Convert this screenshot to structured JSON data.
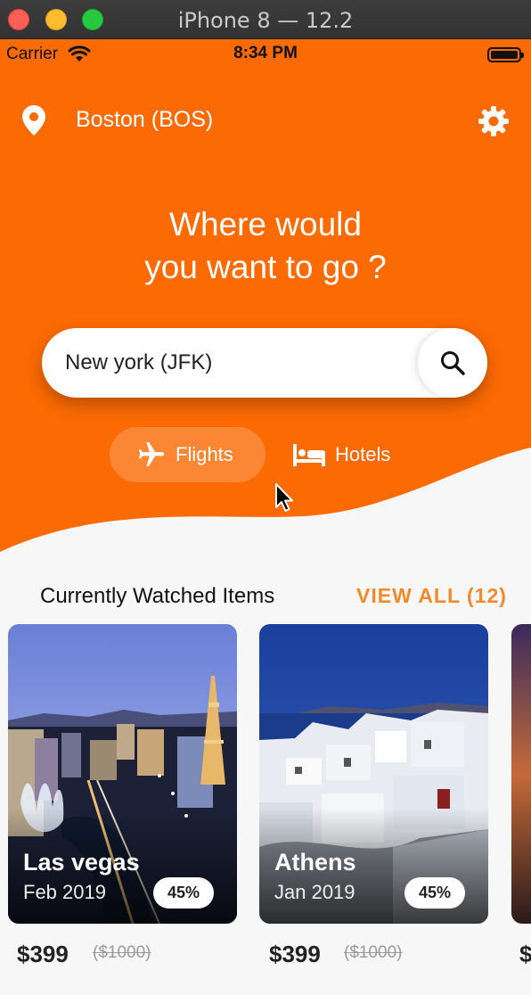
{
  "window": {
    "title": "iPhone 8 — 12.2"
  },
  "statusbar": {
    "carrier": "Carrier",
    "time": "8:34 PM"
  },
  "header": {
    "location": "Boston (BOS)",
    "location_icon": "location-pin-icon",
    "settings_icon": "gear-icon"
  },
  "hero": {
    "line1": "Where would",
    "line2": "you want to go ?"
  },
  "search": {
    "value": "New york (JFK)",
    "icon": "search-icon"
  },
  "tabs": [
    {
      "label": "Flights",
      "icon": "airplane-icon",
      "selected": true
    },
    {
      "label": "Hotels",
      "icon": "bed-icon",
      "selected": false
    }
  ],
  "watched": {
    "title": "Currently Watched Items",
    "view_all": "VIEW ALL (12)",
    "items": [
      {
        "city": "Las vegas",
        "date": "Feb 2019",
        "discount": "45%",
        "price": "$399",
        "old_price": "($1000)"
      },
      {
        "city": "Athens",
        "date": "Jan 2019",
        "discount": "45%",
        "price": "$399",
        "old_price": "($1000)"
      }
    ]
  },
  "colors": {
    "accent": "#fb6a03",
    "view_all": "#f08a2c",
    "background": "#f7f7f7"
  }
}
